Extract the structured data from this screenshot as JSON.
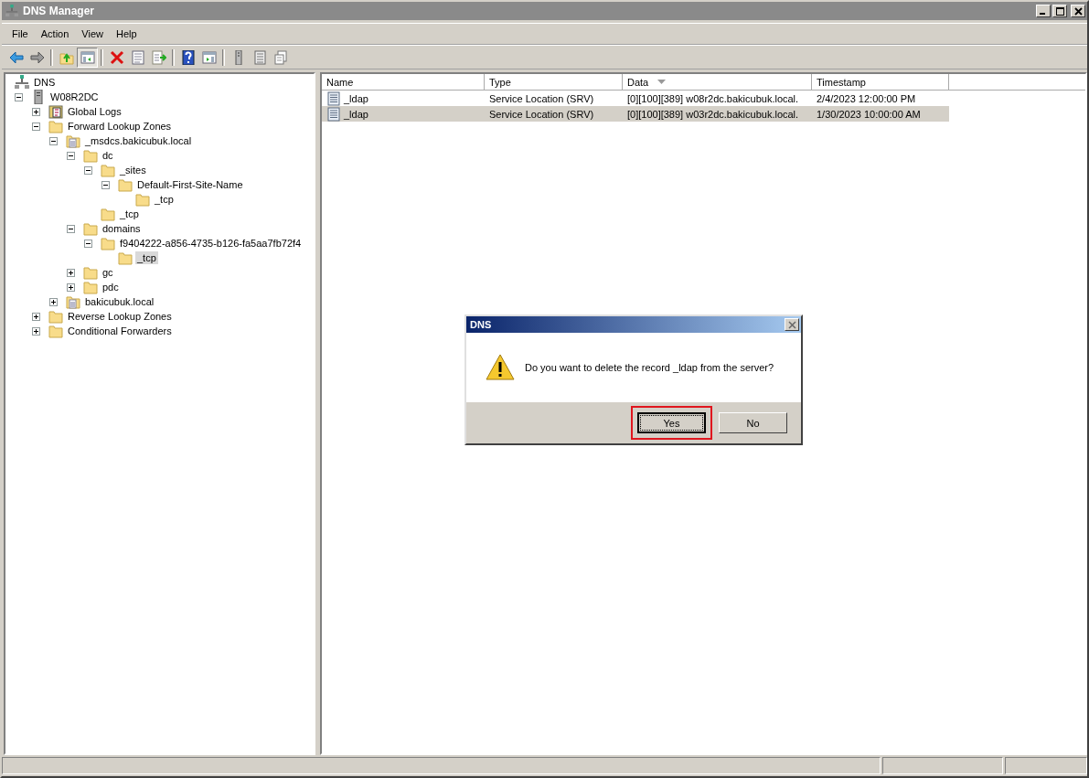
{
  "window": {
    "title": "DNS Manager"
  },
  "menu": [
    "File",
    "Action",
    "View",
    "Help"
  ],
  "toolbar": [
    {
      "kind": "back",
      "pressed": false
    },
    {
      "kind": "forward",
      "pressed": false
    },
    {
      "kind": "sep"
    },
    {
      "kind": "up",
      "pressed": false
    },
    {
      "kind": "tree",
      "pressed": true
    },
    {
      "kind": "sep"
    },
    {
      "kind": "delete",
      "pressed": false
    },
    {
      "kind": "properties",
      "pressed": false
    },
    {
      "kind": "export",
      "pressed": false
    },
    {
      "kind": "sep"
    },
    {
      "kind": "help",
      "pressed": false
    },
    {
      "kind": "pane",
      "pressed": false
    },
    {
      "kind": "sep"
    },
    {
      "kind": "server",
      "pressed": false
    },
    {
      "kind": "list",
      "pressed": false
    },
    {
      "kind": "copy",
      "pressed": false
    }
  ],
  "tree": {
    "label": "DNS",
    "kind": "dns",
    "children": [
      {
        "label": "W08R2DC",
        "kind": "server",
        "expanded": true,
        "selected": false,
        "children": [
          {
            "label": "Global Logs",
            "kind": "logs",
            "expanded": false,
            "selected": false
          },
          {
            "label": "Forward Lookup Zones",
            "kind": "folder",
            "expanded": true,
            "selected": false,
            "children": [
              {
                "label": "_msdcs.bakicubuk.local",
                "kind": "zone",
                "expanded": true,
                "selected": false,
                "children": [
                  {
                    "label": "dc",
                    "kind": "folder",
                    "expanded": true,
                    "selected": false,
                    "children": [
                      {
                        "label": "_sites",
                        "kind": "folder",
                        "expanded": true,
                        "selected": false,
                        "children": [
                          {
                            "label": "Default-First-Site-Name",
                            "kind": "folder",
                            "expanded": true,
                            "selected": false,
                            "children": [
                              {
                                "label": "_tcp",
                                "kind": "folder",
                                "selected": false
                              }
                            ]
                          }
                        ]
                      },
                      {
                        "label": "_tcp",
                        "kind": "folder",
                        "selected": false
                      }
                    ]
                  },
                  {
                    "label": "domains",
                    "kind": "folder",
                    "expanded": true,
                    "selected": false,
                    "children": [
                      {
                        "label": "f9404222-a856-4735-b126-fa5aa7fb72f4",
                        "kind": "folder",
                        "expanded": true,
                        "selected": false,
                        "children": [
                          {
                            "label": "_tcp",
                            "kind": "folder",
                            "selected": true
                          }
                        ]
                      }
                    ]
                  },
                  {
                    "label": "gc",
                    "kind": "folder",
                    "expanded": false,
                    "selected": false
                  },
                  {
                    "label": "pdc",
                    "kind": "folder",
                    "expanded": false,
                    "selected": false
                  }
                ]
              },
              {
                "label": "bakicubuk.local",
                "kind": "zone",
                "expanded": false,
                "selected": false
              }
            ]
          },
          {
            "label": "Reverse Lookup Zones",
            "kind": "folder",
            "expanded": false,
            "selected": false
          },
          {
            "label": "Conditional Forwarders",
            "kind": "folder",
            "expanded": false,
            "selected": false
          }
        ]
      }
    ]
  },
  "table": {
    "columns": [
      {
        "label": "Name",
        "sorted": false
      },
      {
        "label": "Type",
        "sorted": false
      },
      {
        "label": "Data",
        "sorted": true
      },
      {
        "label": "Timestamp",
        "sorted": false
      }
    ],
    "rows": [
      {
        "cells": [
          "_ldap",
          "Service Location (SRV)",
          "[0][100][389] w08r2dc.bakicubuk.local.",
          "2/4/2023 12:00:00 PM"
        ],
        "selected": false
      },
      {
        "cells": [
          "_ldap",
          "Service Location (SRV)",
          "[0][100][389] w03r2dc.bakicubuk.local.",
          "1/30/2023 10:00:00 AM"
        ],
        "selected": true
      }
    ]
  },
  "dialog": {
    "title": "DNS",
    "message": "Do you want to delete the record _ldap from the server?",
    "buttons": [
      {
        "label": "Yes",
        "focused": true,
        "highlighted": true
      },
      {
        "label": "No",
        "focused": false,
        "highlighted": false
      }
    ]
  }
}
